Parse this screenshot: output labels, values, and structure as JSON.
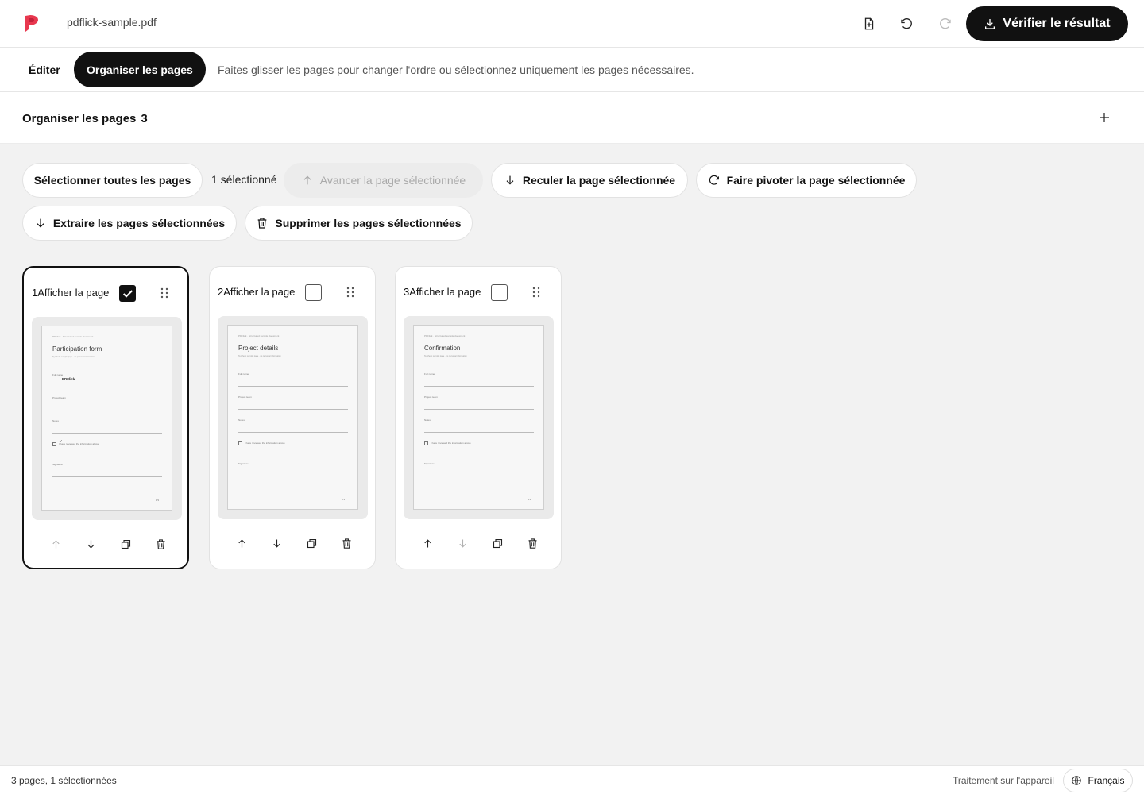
{
  "header": {
    "filename": "pdflick-sample.pdf",
    "brand_color": "#e8384f",
    "icons": [
      "file-plus-icon",
      "undo-icon",
      "redo-icon"
    ],
    "verify_label": "Vérifier le résultat"
  },
  "modes": {
    "edit_label": "Éditer",
    "organize_label": "Organiser les pages",
    "hint": "Faites glisser les pages pour changer l'ordre ou sélectionnez uniquement les pages nécessaires."
  },
  "section": {
    "title": "Organiser les pages",
    "count": "3"
  },
  "toolbar": {
    "select_all": "Sélectionner toutes les pages",
    "selected_count": "1 sélectionné",
    "move_forward": "Avancer la page sélectionnée",
    "move_backward": "Reculer la page sélectionnée",
    "rotate": "Faire pivoter la page sélectionnée",
    "extract": "Extraire les pages sélectionnées",
    "delete": "Supprimer les pages sélectionnées"
  },
  "pages": [
    {
      "label": "1Afficher la page",
      "checked": true,
      "doc_title": "Participation form",
      "header_text": "PDFlick · Structured sample document",
      "subtitle": "Synthetic sample page · no personal information",
      "fields": [
        "Full name",
        "Project team",
        "Notes"
      ],
      "filled_value": "PDFlick",
      "checkbox_text": "I have reviewed the information above",
      "signature_label": "Signature",
      "page_number": "1/3"
    },
    {
      "label": "2Afficher la page",
      "checked": false,
      "doc_title": "Project details",
      "header_text": "PDFlick · Structured sample document",
      "subtitle": "Synthetic sample page · no personal information",
      "fields": [
        "Full name",
        "Project team",
        "Notes"
      ],
      "filled_value": "",
      "checkbox_text": "I have reviewed the information above",
      "signature_label": "Signature",
      "page_number": "2/3"
    },
    {
      "label": "3Afficher la page",
      "checked": false,
      "doc_title": "Confirmation",
      "header_text": "PDFlick · Structured sample document",
      "subtitle": "Synthetic sample page · no personal information",
      "fields": [
        "Full name",
        "Project team",
        "Notes"
      ],
      "filled_value": "",
      "checkbox_text": "I have reviewed the information above",
      "signature_label": "Signature",
      "page_number": "3/3"
    }
  ],
  "footer": {
    "status": "3 pages, 1 sélectionnées",
    "processing": "Traitement sur l'appareil",
    "language": "Français"
  }
}
